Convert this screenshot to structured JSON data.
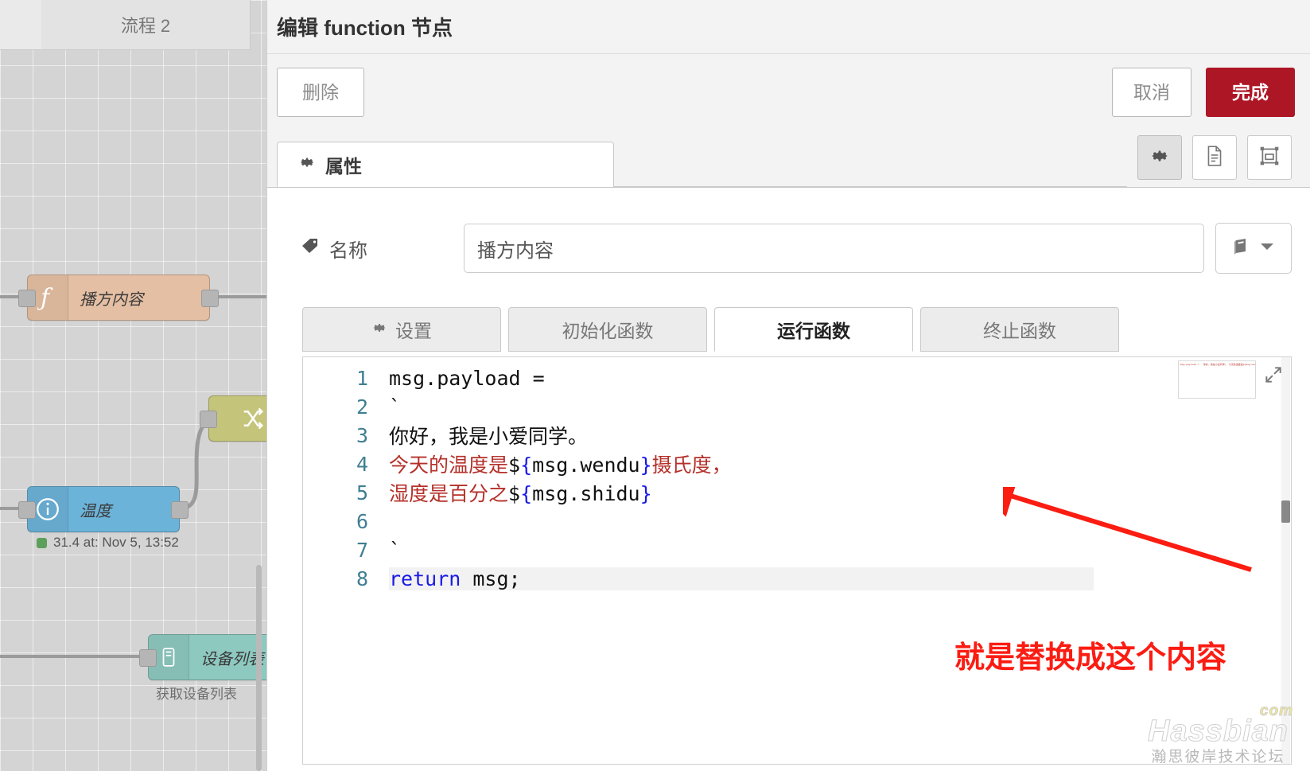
{
  "canvas": {
    "flow_tab_label": "流程 2",
    "nodes": [
      {
        "label": "播方内容",
        "icon": "function-icon",
        "color": "#e5bfa3"
      },
      {
        "label": "温度",
        "icon": "info-icon",
        "color": "#6cb3d9"
      },
      {
        "label": "",
        "icon": "switch-icon",
        "color": "#c4c47a"
      },
      {
        "label": "设备列表",
        "icon": "device-icon",
        "color": "#8ec9c0"
      }
    ],
    "status_text": "31.4 at: Nov 5, 13:52",
    "sub_label": "获取设备列表"
  },
  "dialog": {
    "title": "编辑 function 节点",
    "delete_label": "删除",
    "cancel_label": "取消",
    "done_label": "完成",
    "done_color": "#ad1625",
    "tab_properties_label": "属性",
    "icon_buttons": [
      {
        "name": "gear-icon",
        "active": true
      },
      {
        "name": "document-icon",
        "active": false
      },
      {
        "name": "group-select-icon",
        "active": false
      }
    ],
    "name_label": "名称",
    "name_value": "播方内容",
    "name_placeholder": "名称",
    "subtabs": [
      {
        "label": "设置",
        "icon": "gear-icon",
        "active": false
      },
      {
        "label": "初始化函数",
        "icon": "",
        "active": false
      },
      {
        "label": "运行函数",
        "icon": "",
        "active": true
      },
      {
        "label": "终止函数",
        "icon": "",
        "active": false
      }
    ]
  },
  "code": {
    "lines": [
      {
        "num": "1",
        "text": "msg.payload =",
        "active": false
      },
      {
        "num": "2",
        "text": "`",
        "active": false
      },
      {
        "num": "3",
        "text": "你好，我是小爱同学。",
        "active": false
      },
      {
        "num": "4",
        "text": "今天的温度是${msg.wendu}摄氏度，",
        "active": false
      },
      {
        "num": "5",
        "text": "湿度是百分之${msg.shidu}",
        "active": false
      },
      {
        "num": "6",
        "text": "",
        "active": false
      },
      {
        "num": "7",
        "text": "`",
        "active": false
      },
      {
        "num": "8",
        "text": "return msg;",
        "active": true
      }
    ],
    "minimap_text": "msg.payload = ` 你好，我是小爱同学。 今天的温度是${msg.wendu}摄氏度， 湿度是百分之${msg.shidu} ` return msg;"
  },
  "annotation": {
    "text": "就是替换成这个内容",
    "color": "#fb1c12"
  },
  "watermark": {
    "brand": "Hassbian",
    "tld": "com",
    "subtitle": "瀚思彼岸技术论坛"
  }
}
